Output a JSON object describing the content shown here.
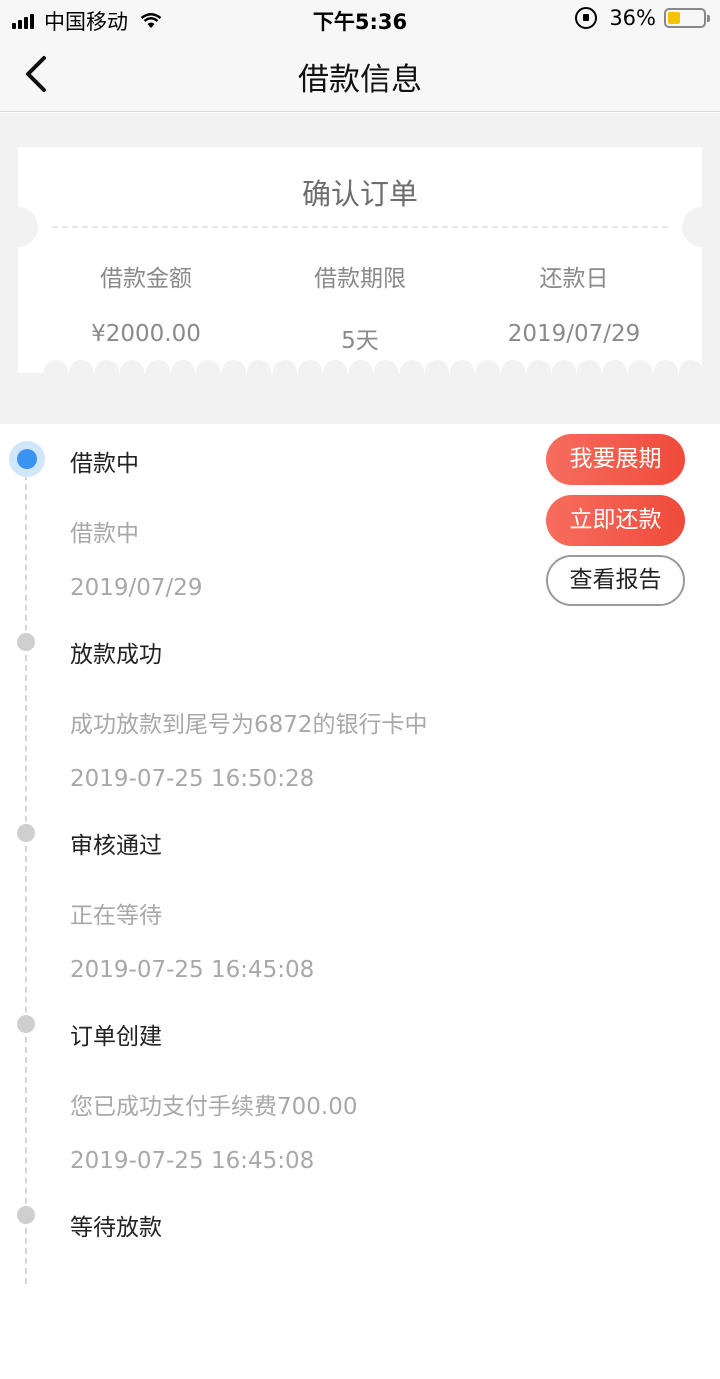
{
  "status_bar": {
    "carrier": "中国移动",
    "time": "下午5:36",
    "battery_percent": "36%",
    "battery_level": 0.36,
    "battery_color": "#f5c400"
  },
  "nav": {
    "title": "借款信息",
    "back_icon": "chevron-left-icon"
  },
  "ticket": {
    "title": "确认订单",
    "columns": [
      {
        "label": "借款金额",
        "value": "¥2000.00"
      },
      {
        "label": "借款期限",
        "value": "5天"
      },
      {
        "label": "还款日",
        "value": "2019/07/29"
      }
    ]
  },
  "actions": {
    "extend": "我要展期",
    "repay": "立即还款",
    "report": "查看报告",
    "accent_color": "#f25c4a"
  },
  "timeline": [
    {
      "title": "借款中",
      "desc": "借款中",
      "time": "2019/07/29",
      "active": true
    },
    {
      "title": "放款成功",
      "desc": "成功放款到尾号为6872的银行卡中",
      "time": "2019-07-25 16:50:28",
      "active": false
    },
    {
      "title": "审核通过",
      "desc": "正在等待",
      "time": "2019-07-25 16:45:08",
      "active": false
    },
    {
      "title": "订单创建",
      "desc": "您已成功支付手续费700.00",
      "time": "2019-07-25 16:45:08",
      "active": false
    },
    {
      "title": "等待放款",
      "active": false
    }
  ],
  "colors": {
    "active_dot": "#3b95f0",
    "inactive_dot": "#cfcfcf"
  }
}
